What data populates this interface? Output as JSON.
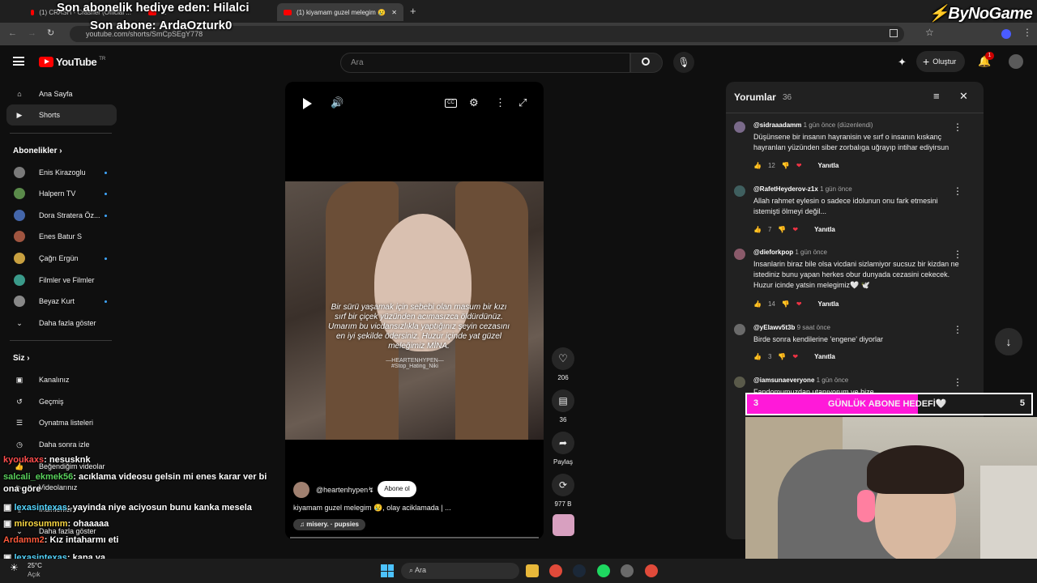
{
  "browser": {
    "tabs": [
      {
        "label": "(1) CRASH - Crasher (Official ...",
        "active": false
      },
      {
        "label": "...",
        "active": false
      },
      {
        "label": "(1) kiyamam guzel melegim 😢",
        "active": true
      }
    ],
    "new_tab": "+",
    "url": "youtube.com/shorts/SmCpSEgY778"
  },
  "stream": {
    "gift_label": "Son abonelik hediye eden: Hilalci",
    "last_sub_label": "Son abone: ArdaOzturk0",
    "logo": "ByNoGame",
    "goal": {
      "current": "3",
      "label": "GÜNLÜK ABONE HEDEFİ🤍",
      "target": "5",
      "progress": 0.6
    }
  },
  "header": {
    "logo": "YouTube",
    "logo_sup": "TR",
    "search_placeholder": "Ara",
    "create_label": "Oluştur",
    "notif_count": "1"
  },
  "sidebar": {
    "main": [
      {
        "label": "Ana Sayfa",
        "icon": "home-icon"
      },
      {
        "label": "Shorts",
        "icon": "shorts-icon"
      }
    ],
    "subs_title": "Abonelikler",
    "subs": [
      {
        "label": "Enis Kirazoglu"
      },
      {
        "label": "Halpern TV"
      },
      {
        "label": "Dora Stratera Öz..."
      },
      {
        "label": "Enes Batur S"
      },
      {
        "label": "Çağrı Ergün"
      },
      {
        "label": "Filmler ve Filmler"
      },
      {
        "label": "Beyaz Kurt"
      }
    ],
    "show_more": "Daha fazla göster",
    "you_title": "Siz",
    "you": [
      {
        "label": "Kanalınız"
      },
      {
        "label": "Geçmiş"
      },
      {
        "label": "Oynatma listeleri"
      },
      {
        "label": "Daha sonra izle"
      },
      {
        "label": "Beğendiğim videolar"
      },
      {
        "label": "Videolarınız"
      },
      {
        "label": "İndirilenler"
      },
      {
        "label": "Daha fazla göster"
      }
    ]
  },
  "short": {
    "caption": "Bir sürü yaşamak için sebebi olan masum bir kızı sırf bir çiçek yüzünden acımasızca öldürdünüz. Umarım bu vicdansızlıkla yaptığınız şeyin cezasını en iyi şekilde ödersiniz. Huzur içinde yat güzel meleğimiz MİNA.",
    "watermark": "—HEARTENHYPEN—\n#Stop_Hating_Niki",
    "channel": "@heartenhypen↯",
    "subscribe": "Abone ol",
    "title": "kiyamam guzel melegim 😢, olay aciklamada | ...",
    "music": "misery. · pupsies",
    "likes": "206",
    "comments": "36",
    "share": "Paylaş",
    "remix": "977 B"
  },
  "comments_panel": {
    "title": "Yorumlar",
    "count": "36",
    "items": [
      {
        "user": "@sidraaadamm",
        "time": "1 gün önce (düzenlendi)",
        "text": "Düşünsene bir insanın hayranisin ve sırf o insanın kıskanç hayranları yüzünden siber zorbalıga uğrayıp intihar ediyirsun",
        "likes": "12",
        "reply": "Yanıtla"
      },
      {
        "user": "@RafetHeyderov-z1x",
        "time": "1 gün önce",
        "text": "Allah rahmet eylesin o sadece idolunun onu fark etmesini istemişti ölmeyi değil...",
        "likes": "7",
        "reply": "Yanıtla"
      },
      {
        "user": "@dieforkpop",
        "time": "1 gün önce",
        "text": "Insanlarin biraz bile olsa vicdani sizlamiyor sucsuz bir kizdan ne istediniz bunu yapan herkes obur dunyada cezasini cekecek. Huzur icinde yatsin melegimiz🤍 🕊️",
        "likes": "14",
        "reply": "Yanıtla"
      },
      {
        "user": "@yElawv5t3b",
        "time": "9 saat önce",
        "text": "Birde sonra kendilerine 'engene' diyorlar",
        "likes": "3",
        "reply": "Yanıtla"
      },
      {
        "user": "@iamsunaeveryone",
        "time": "1 gün önce",
        "text": "Fandomumuzdan utanıyorum ve bize ... ",
        "likes": "",
        "reply": ""
      }
    ]
  },
  "chat": [
    {
      "user": "kyoukaxs",
      "msg": ": nesusknk",
      "color": "#ff4d4d"
    },
    {
      "user": "salcali_ekmek56",
      "msg": ": acıklama videosu gelsin mi enes karar ver bi ona göre",
      "color": "#59d15c"
    },
    {
      "user": "lexasintexas",
      "msg": ": yayinda niye aciyosun bunu kanka mesela",
      "color": "#54d6ff"
    },
    {
      "user": "mirosummm",
      "msg": ": ohaaaaa",
      "color": "#f5d442"
    },
    {
      "user": "Ardamm2",
      "msg": ": Kız intaharmı eti",
      "color": "#ff5a3c"
    },
    {
      "user": "lexasintexas",
      "msg": ": kapa ya",
      "color": "#54d6ff"
    }
  ],
  "taskbar": {
    "weather": "25°C",
    "weather_sub": "Açık",
    "search": "Ara"
  }
}
